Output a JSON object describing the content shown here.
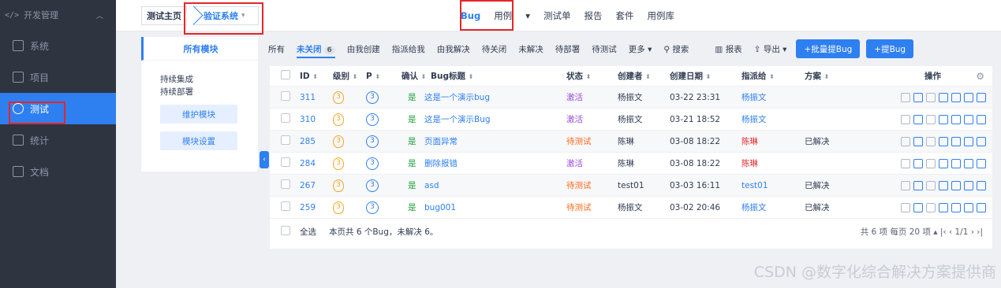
{
  "sidebar": {
    "header": "开发管理",
    "items": [
      {
        "label": "系统",
        "icon": "grid-icon"
      },
      {
        "label": "项目",
        "icon": "swap-icon"
      },
      {
        "label": "测试",
        "icon": "test-icon"
      },
      {
        "label": "统计",
        "icon": "chart-icon"
      },
      {
        "label": "文档",
        "icon": "doc-icon"
      }
    ]
  },
  "breadcrumb": {
    "home": "测试主页",
    "current": "验证系统"
  },
  "topnav": [
    "Bug",
    "用例",
    "测试单",
    "报告",
    "套件",
    "用例库"
  ],
  "modules": {
    "title": "所有模块",
    "items": [
      "持续集成",
      "持续部署"
    ],
    "maintain_btn": "维护模块",
    "settings_btn": "模块设置"
  },
  "filters": {
    "all": "所有",
    "unclosed": "未关闭",
    "unclosed_count": "6",
    "tabs": [
      "由我创建",
      "指派给我",
      "由我解决",
      "待关闭",
      "未解决",
      "待部署",
      "待测试"
    ],
    "more": "更多",
    "search": "搜索",
    "report": "报表",
    "export": "导出",
    "batch_add": "+批量提Bug",
    "add": "+提Bug"
  },
  "table": {
    "headers": {
      "id": "ID",
      "level": "级别",
      "p": "P",
      "confirmed": "确认",
      "title": "Bug标题",
      "status": "状态",
      "creator": "创建者",
      "date": "创建日期",
      "assignee": "指派给",
      "solution": "方案",
      "ops": "操作"
    },
    "rows": [
      {
        "id": "311",
        "level": "3",
        "p": "3",
        "confirmed": "是",
        "title": "这是一个演示bug",
        "status": "激活",
        "creator": "杨振文",
        "date": "03-22 23:31",
        "assignee": "杨振文",
        "solution": ""
      },
      {
        "id": "310",
        "level": "3",
        "p": "3",
        "confirmed": "是",
        "title": "这是一个演示Bug",
        "status": "激活",
        "creator": "杨振文",
        "date": "03-21 18:52",
        "assignee": "杨振文",
        "solution": ""
      },
      {
        "id": "285",
        "level": "3",
        "p": "3",
        "confirmed": "是",
        "title": "页面异常",
        "status": "待测试",
        "creator": "陈琳",
        "date": "03-08 18:22",
        "assignee": "陈琳",
        "solution": "已解决"
      },
      {
        "id": "284",
        "level": "3",
        "p": "3",
        "confirmed": "是",
        "title": "删除报错",
        "status": "激活",
        "creator": "陈琳",
        "date": "03-08 18:22",
        "assignee": "陈琳",
        "solution": ""
      },
      {
        "id": "267",
        "level": "3",
        "p": "3",
        "confirmed": "是",
        "title": "asd",
        "status": "待测试",
        "creator": "test01",
        "date": "03-03 16:11",
        "assignee": "test01",
        "solution": "已解决"
      },
      {
        "id": "259",
        "level": "3",
        "p": "3",
        "confirmed": "是",
        "title": "bug001",
        "status": "待测试",
        "creator": "杨振文",
        "date": "03-02 20:46",
        "assignee": "杨振文",
        "solution": "已解决"
      }
    ],
    "footer": {
      "select_all": "全选",
      "summary": "本页共 6 个Bug，未解决 6。",
      "pager": "共 6 项   每页 20 项 ▴   |‹  ‹  1/1  ›  ›|"
    }
  },
  "watermark": "CSDN @数字化综合解决方案提供商"
}
